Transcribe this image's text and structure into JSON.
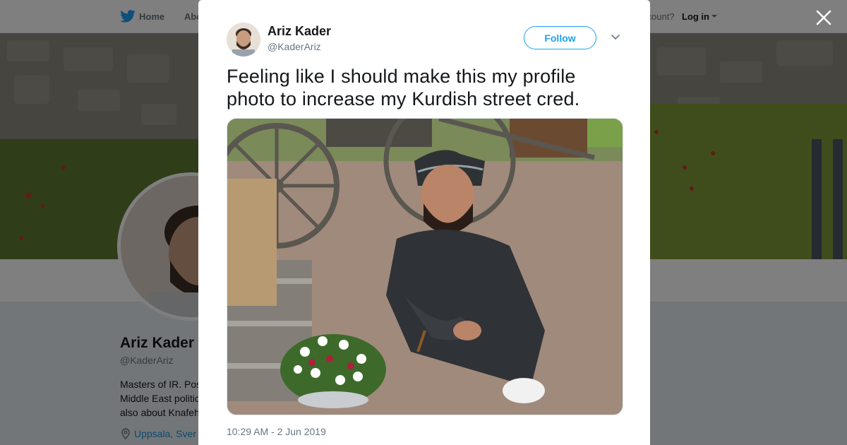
{
  "nav": {
    "home_label": "Home",
    "about_label": "Abo",
    "account_prompt": "ccount?",
    "login_label": "Log in"
  },
  "profile": {
    "name": "Ariz Kader",
    "handle": "@KaderAriz",
    "bio_lines": [
      "Masters of IR. Pos",
      "Middle East politic",
      "also about Knafeh"
    ],
    "location": "Uppsala, Sver"
  },
  "tweet": {
    "author_name": "Ariz Kader",
    "author_handle": "@KaderAriz",
    "follow_label": "Follow",
    "text": "Feeling like I should make this my profile photo to increase my Kurdish street cred.",
    "timestamp": "10:29 AM - 2 Jun 2019"
  },
  "colors": {
    "accent": "#1da1f2",
    "overlay": "rgba(0,0,0,0.5)"
  }
}
